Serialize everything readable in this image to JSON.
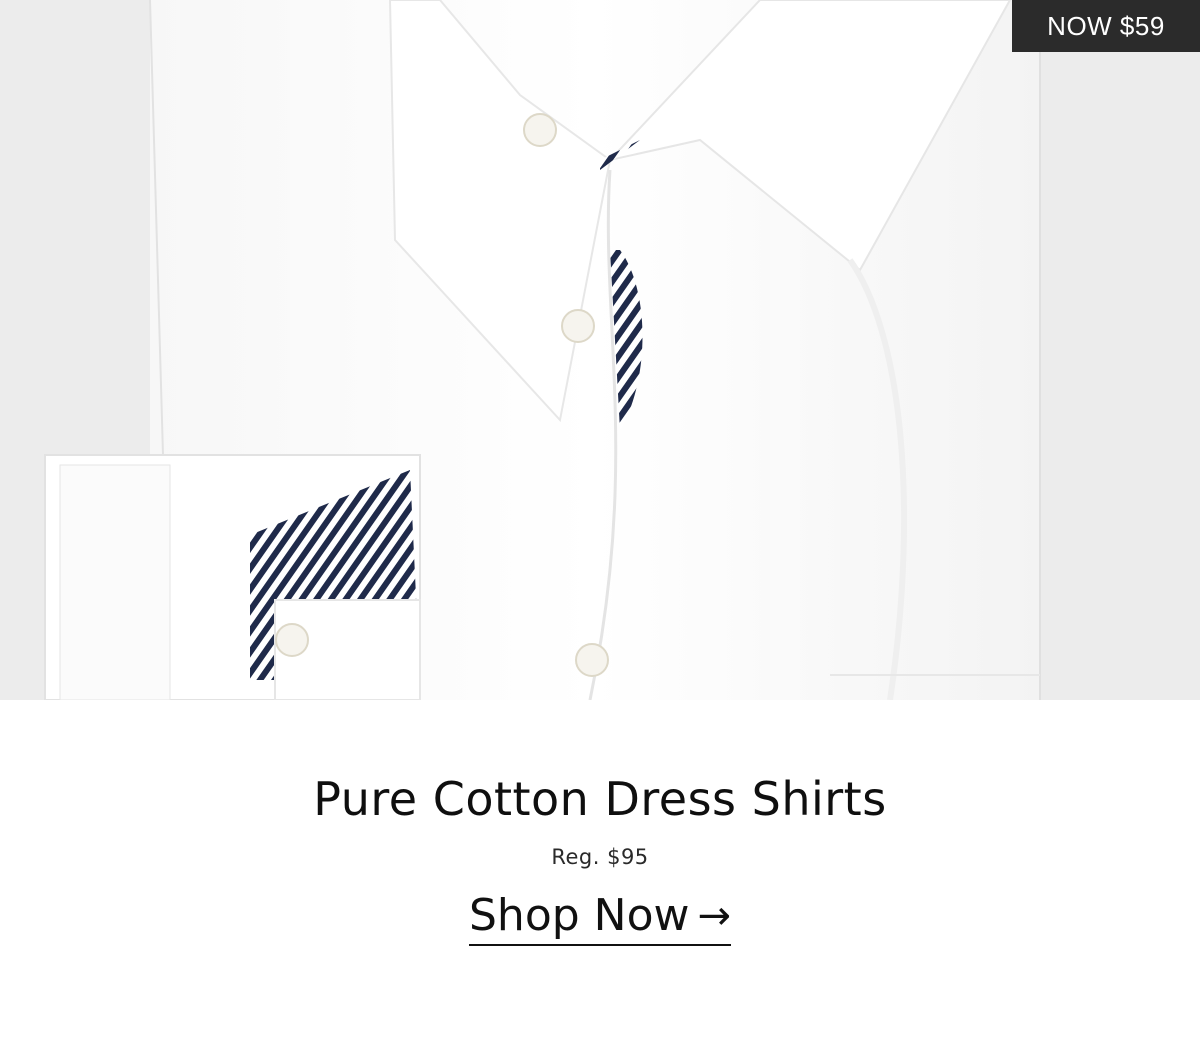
{
  "hero": {
    "image_alt": "white shirt",
    "badge_text": "NOW $59"
  },
  "product": {
    "title": "Pure Cotton Dress Shirts",
    "regular_price": "Reg. $95"
  },
  "cta": {
    "label": "Shop Now",
    "arrow_icon": "arrow-right-icon",
    "arrow_glyph": "→"
  },
  "colors": {
    "background": "#ececec",
    "badge": "#2b2b2b",
    "stripe": "#1f2a4a",
    "text": "#111111"
  }
}
